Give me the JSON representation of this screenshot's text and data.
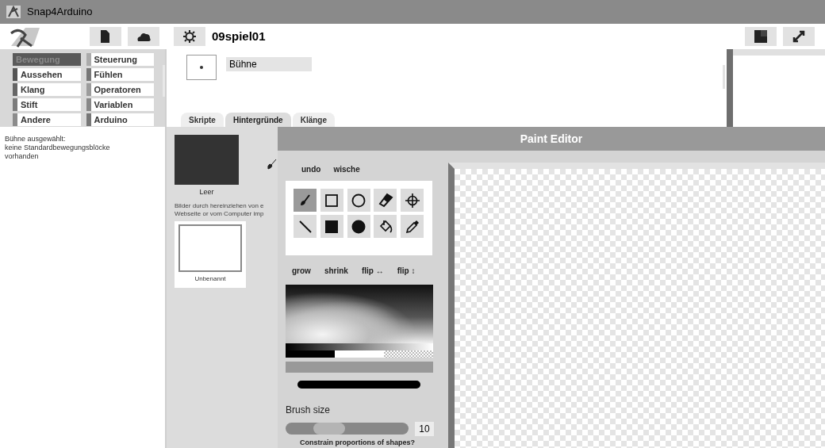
{
  "window": {
    "title": "Snap4Arduino"
  },
  "toolbar": {
    "project_name": "09spiel01"
  },
  "categories": [
    {
      "label": "Bewegung",
      "selected": true,
      "color": "#5a5a5a"
    },
    {
      "label": "Steuerung",
      "selected": false,
      "color": "#ababab"
    },
    {
      "label": "Aussehen",
      "selected": false,
      "color": "#555555"
    },
    {
      "label": "Fühlen",
      "selected": false,
      "color": "#777777"
    },
    {
      "label": "Klang",
      "selected": false,
      "color": "#666666"
    },
    {
      "label": "Operatoren",
      "selected": false,
      "color": "#9c9c9c"
    },
    {
      "label": "Stift",
      "selected": false,
      "color": "#7c7c7c"
    },
    {
      "label": "Variablen",
      "selected": false,
      "color": "#888888"
    },
    {
      "label": "Andere",
      "selected": false,
      "color": "#8c8c8c"
    },
    {
      "label": "Arduino",
      "selected": false,
      "color": "#777777"
    }
  ],
  "palette_message": "Bühne ausgewählt:\nkeine Standardbewegungsblöcke\nvorhanden",
  "sprite": {
    "name": "Bühne"
  },
  "tabs": [
    {
      "label": "Skripte",
      "selected": false
    },
    {
      "label": "Hintergründe",
      "selected": true
    },
    {
      "label": "Klänge",
      "selected": false
    }
  ],
  "costumes": {
    "paint_label": "Leer",
    "hint": "Bilder durch hereinziehen von e\nWebseite or vom Computer imp",
    "items": [
      {
        "name": "Unbenannt"
      }
    ]
  },
  "paint_editor": {
    "title": "Paint Editor",
    "actions": [
      "undo",
      "wische"
    ],
    "tools": [
      {
        "kind": "brush",
        "selected": true
      },
      {
        "kind": "rectangle",
        "selected": false
      },
      {
        "kind": "circle",
        "selected": false
      },
      {
        "kind": "eraser",
        "selected": false
      },
      {
        "kind": "crosshair",
        "selected": false
      },
      {
        "kind": "line",
        "selected": false
      },
      {
        "kind": "filled-rectangle",
        "selected": false
      },
      {
        "kind": "filled-circle",
        "selected": false
      },
      {
        "kind": "paint-bucket",
        "selected": false
      },
      {
        "kind": "eyedropper",
        "selected": false
      }
    ],
    "transforms": [
      "grow",
      "shrink",
      "flip ↔",
      "flip ↕"
    ],
    "brush_size_label": "Brush size",
    "brush_size": {
      "level": 0.3,
      "value": "10"
    },
    "constrain_label": "Constrain proportions of shapes?"
  }
}
